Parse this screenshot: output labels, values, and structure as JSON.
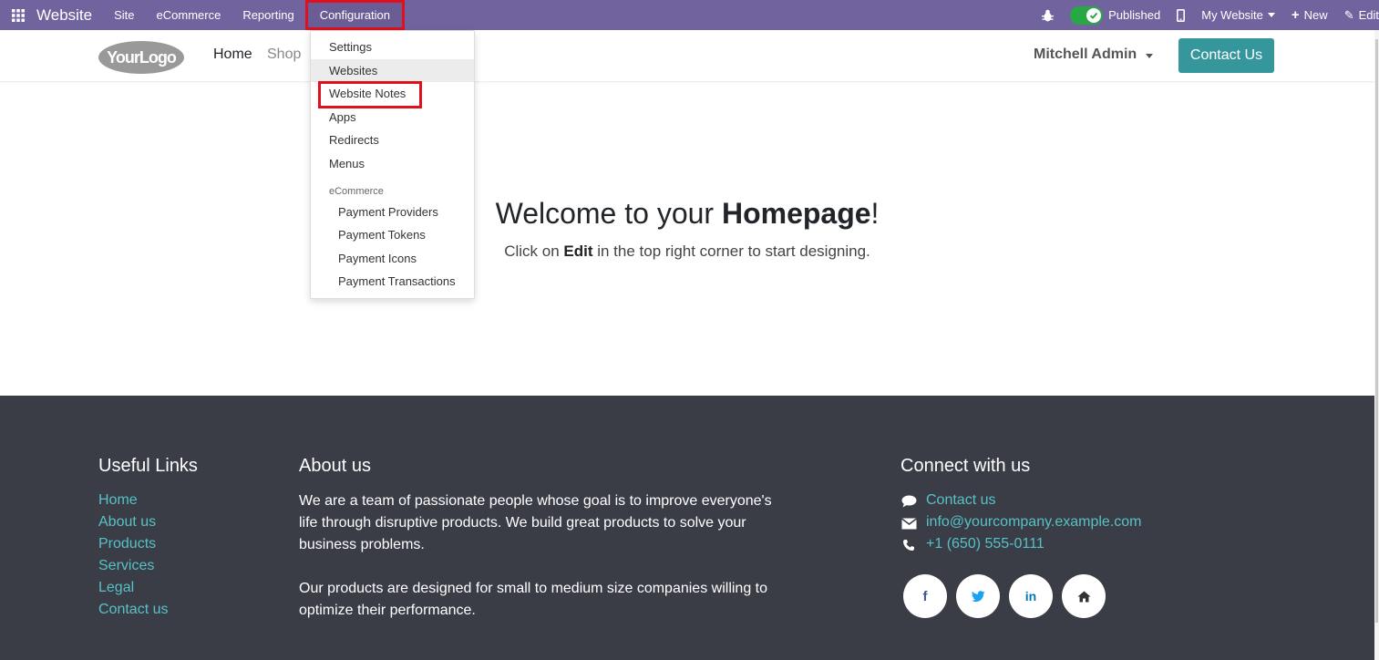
{
  "topbar": {
    "brand": "Website",
    "menu": [
      "Site",
      "eCommerce",
      "Reporting",
      "Configuration"
    ],
    "published_label": "Published",
    "my_website_label": "My Website",
    "new_label": "New",
    "edit_label": "Edit"
  },
  "header": {
    "logo_text": "YourLogo",
    "nav": [
      "Home",
      "Shop"
    ],
    "admin_name": "Mitchell Admin",
    "contact_button": "Contact Us"
  },
  "dropdown": {
    "items": [
      "Settings",
      "Websites",
      "Website Notes",
      "Apps",
      "Redirects",
      "Menus"
    ],
    "section_label": "eCommerce",
    "sub_items": [
      "Payment Providers",
      "Payment Tokens",
      "Payment Icons",
      "Payment Transactions"
    ],
    "highlighted": "Websites"
  },
  "hero": {
    "title_prefix": "Welcome to your ",
    "title_bold": "Homepage",
    "title_suffix": "!",
    "sub_prefix": "Click on ",
    "sub_bold": "Edit",
    "sub_suffix": " in the top right corner to start designing."
  },
  "footer": {
    "useful_links_title": "Useful Links",
    "useful_links": [
      "Home",
      "About us",
      "Products",
      "Services",
      "Legal",
      "Contact us"
    ],
    "about_title": "About us",
    "about_lines_1": [
      "We are a team of passionate people whose goal is to improve everyone's",
      "life through disruptive products. We build great products to solve your",
      "business problems."
    ],
    "about_lines_2": [
      "Our products are designed for small to medium size companies willing to",
      "optimize their performance."
    ],
    "connect_title": "Connect with us",
    "contact_label": "Contact us",
    "email": "info@yourcompany.example.com",
    "phone": "+1 (650) 555-0111",
    "social_icons": [
      "facebook-icon",
      "twitter-icon",
      "linkedin-icon",
      "home-icon"
    ]
  },
  "colors": {
    "topbar_bg": "#71639e",
    "accent": "#35979c",
    "footer_bg": "#3a3d46",
    "footer_link": "#56c1c6",
    "highlight_box": "#e0101e"
  }
}
